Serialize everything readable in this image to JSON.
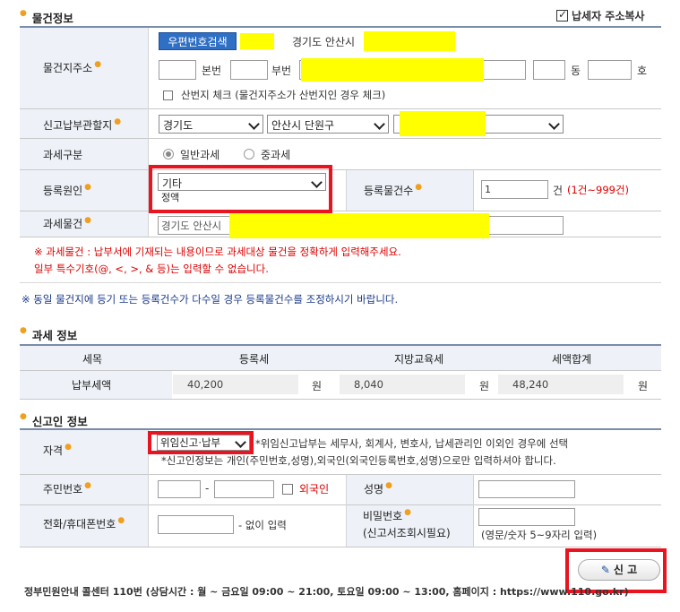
{
  "property_section": {
    "title": "물건정보",
    "copy_address_label": "납세자 주소복사",
    "copy_address_checked": true
  },
  "address": {
    "label": "물건지주소",
    "zip_button": "우편번호검색",
    "region_text": "경기도 안산시",
    "main_no_label": "본번",
    "sub_no_label": "부번",
    "dong_label": "동",
    "ho_label": "호",
    "mountain_label": "산번지 체크 (물건지주소가 산번지인 경우 체크)"
  },
  "office": {
    "label": "신고납부관할지",
    "sel1": "경기도",
    "sel2": "안산시 단원구",
    "sel3": ""
  },
  "tax_type": {
    "label": "과세구분",
    "opt1": "일반과세",
    "opt2": "중과세"
  },
  "reg_cause": {
    "label": "등록원인",
    "selected": "기타",
    "option_below": "정액"
  },
  "reg_count": {
    "label": "등록물건수",
    "value": "1",
    "unit": "건",
    "range": "(1건~999건)"
  },
  "tax_object": {
    "label": "과세물건",
    "value": "경기도 안산시"
  },
  "notes": {
    "red1": "※ 과세물건 : 납부서에 기재되는 내용이므로 과세대상 물건을 정확하게 입력해주세요.",
    "red2": "일부 특수기호(@, <, >, & 등)는 입력할 수 없습니다.",
    "blue": "※ 동일 물건지에 등기 또는 등록건수가 다수일 경우 등록물건수를 조정하시기 바랍니다."
  },
  "tax_info": {
    "title": "과세 정보",
    "headers": [
      "세목",
      "등록세",
      "지방교육세",
      "세액합계"
    ],
    "row_label": "납부세액",
    "values": [
      "40,200",
      "8,040",
      "48,240"
    ],
    "unit": "원"
  },
  "reporter": {
    "title": "신고인 정보",
    "qual_label": "자격",
    "qual_selected": "위임신고·납부",
    "qual_note1": "*위임신고납부는 세무사, 회계사, 변호사, 납세관리인 이외인 경우에 선택",
    "qual_note2": "*신고인정보는 개인(주민번호,성명),외국인(외국인등록번호,성명)으로만 입력하셔야 합니다.",
    "rrn_label": "주민번호",
    "rrn_dash": "-",
    "foreigner_label": "외국인",
    "name_label": "성명",
    "phone_label": "전화/휴대폰번호",
    "phone_hint": "- 없이 입력",
    "pw_label1": "비밀번호",
    "pw_label2": "(신고서조회시필요)",
    "pw_hint": "(영문/숫자 5~9자리 입력)"
  },
  "submit_label": "신 고",
  "footer": "정부민원안내 콜센터 110번 (상담시간 : 월 ~ 금요일 09:00 ~ 21:00, 토요일 09:00 ~ 13:00, 홈페이지 : https://www.110.go.kr)"
}
